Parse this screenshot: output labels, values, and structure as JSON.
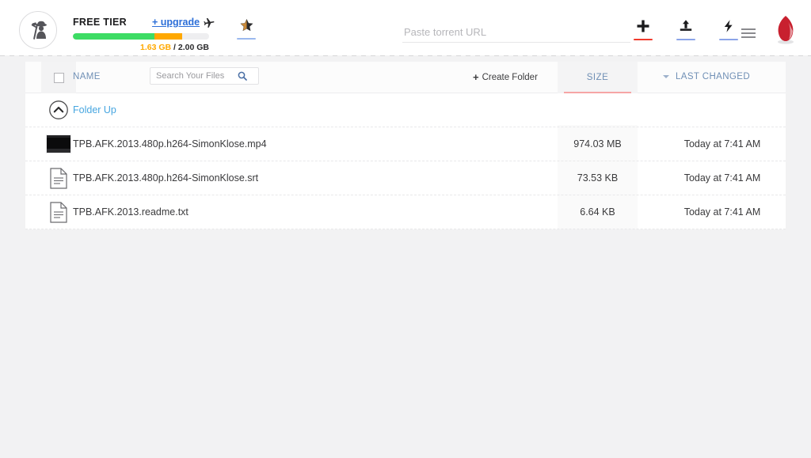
{
  "header": {
    "avatar_icon": "pirate-miner-avatar-icon",
    "tier_label": "FREE TIER",
    "upgrade_label": "+ upgrade",
    "plane_icon": "airplane-icon",
    "storage": {
      "used": "1.63 GB",
      "separator": " / ",
      "total": "2.00 GB",
      "green_pct": 60,
      "orange_pct": 20.5,
      "green_color": "#3ddc64",
      "orange_color": "#ffa800",
      "track_color": "#eeeef0"
    },
    "star_tab": {
      "icon": "star-icon",
      "underline_color": "#9bb9ef"
    },
    "url_input": {
      "placeholder": "Paste torrent URL",
      "value": ""
    },
    "actions": [
      {
        "icon": "plus-icon",
        "underline_color": "#f03b2d"
      },
      {
        "icon": "upload-icon",
        "underline_color": "#8ba4e8"
      },
      {
        "icon": "magnet-bolt-icon",
        "underline_color": "#8ba4e8"
      }
    ],
    "menu_icon": "hamburger-menu-icon",
    "profile_icon": "red-leaf-avatar-icon",
    "profile_color": "#c8202f"
  },
  "toolbar": {
    "select_all_checkbox": false,
    "name_column_label": "NAME",
    "file_search": {
      "placeholder": "Search Your Files",
      "value": "",
      "icon": "search-icon"
    },
    "create_folder_label": "Create Folder",
    "create_folder_icon": "plus-icon",
    "size_column_label": "SIZE",
    "size_column_active": true,
    "size_active_underline": "#f6a5a5",
    "last_changed_label": "LAST CHANGED",
    "last_changed_caret": "chevron-down-icon"
  },
  "folder_up": {
    "icon": "circle-chevron-up-icon",
    "label": "Folder Up"
  },
  "files": [
    {
      "icon": "video-thumbnail",
      "name": "TPB.AFK.2013.480p.h264-SimonKlose.mp4",
      "size": "974.03 MB",
      "changed": "Today at 7:41 AM"
    },
    {
      "icon": "document-icon",
      "name": "TPB.AFK.2013.480p.h264-SimonKlose.srt",
      "size": "73.53 KB",
      "changed": "Today at 7:41 AM"
    },
    {
      "icon": "document-icon",
      "name": "TPB.AFK.2013.readme.txt",
      "size": "6.64 KB",
      "changed": "Today at 7:41 AM"
    }
  ]
}
